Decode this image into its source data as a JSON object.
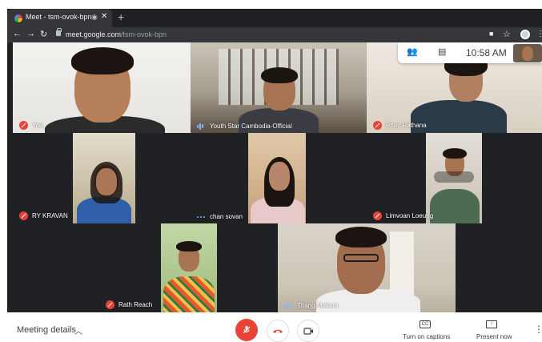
{
  "browser": {
    "tab_title": "Meet - tsm-ovok-bpn",
    "tab_audio_icon": "speaker-icon",
    "new_tab": "+",
    "url_host": "meet.google.com",
    "url_path": "/tsm-ovok-bpn"
  },
  "meet": {
    "time": "10:58 AM",
    "participants": [
      {
        "name": "You",
        "audio": "muted"
      },
      {
        "name": "Youth Star Cambodia-Official",
        "audio": "speaking"
      },
      {
        "name": "Phay Rathana",
        "audio": "muted"
      },
      {
        "name": "RY KRAVAN",
        "audio": "muted"
      },
      {
        "name": "chan sovan",
        "audio": "quiet"
      },
      {
        "name": "Limvoan Loeung",
        "audio": "muted"
      },
      {
        "name": "Rath Reach",
        "audio": "muted"
      },
      {
        "name": "Thang Makara",
        "audio": "speaking"
      }
    ]
  },
  "bottom_bar": {
    "meeting_details": "Meeting details",
    "captions": "Turn on captions",
    "captions_icon": "CC",
    "present": "Present now"
  },
  "colors": {
    "accent_red": "#ea4335",
    "grid_bg": "#202124",
    "audio_blue": "#8ab4f8"
  }
}
